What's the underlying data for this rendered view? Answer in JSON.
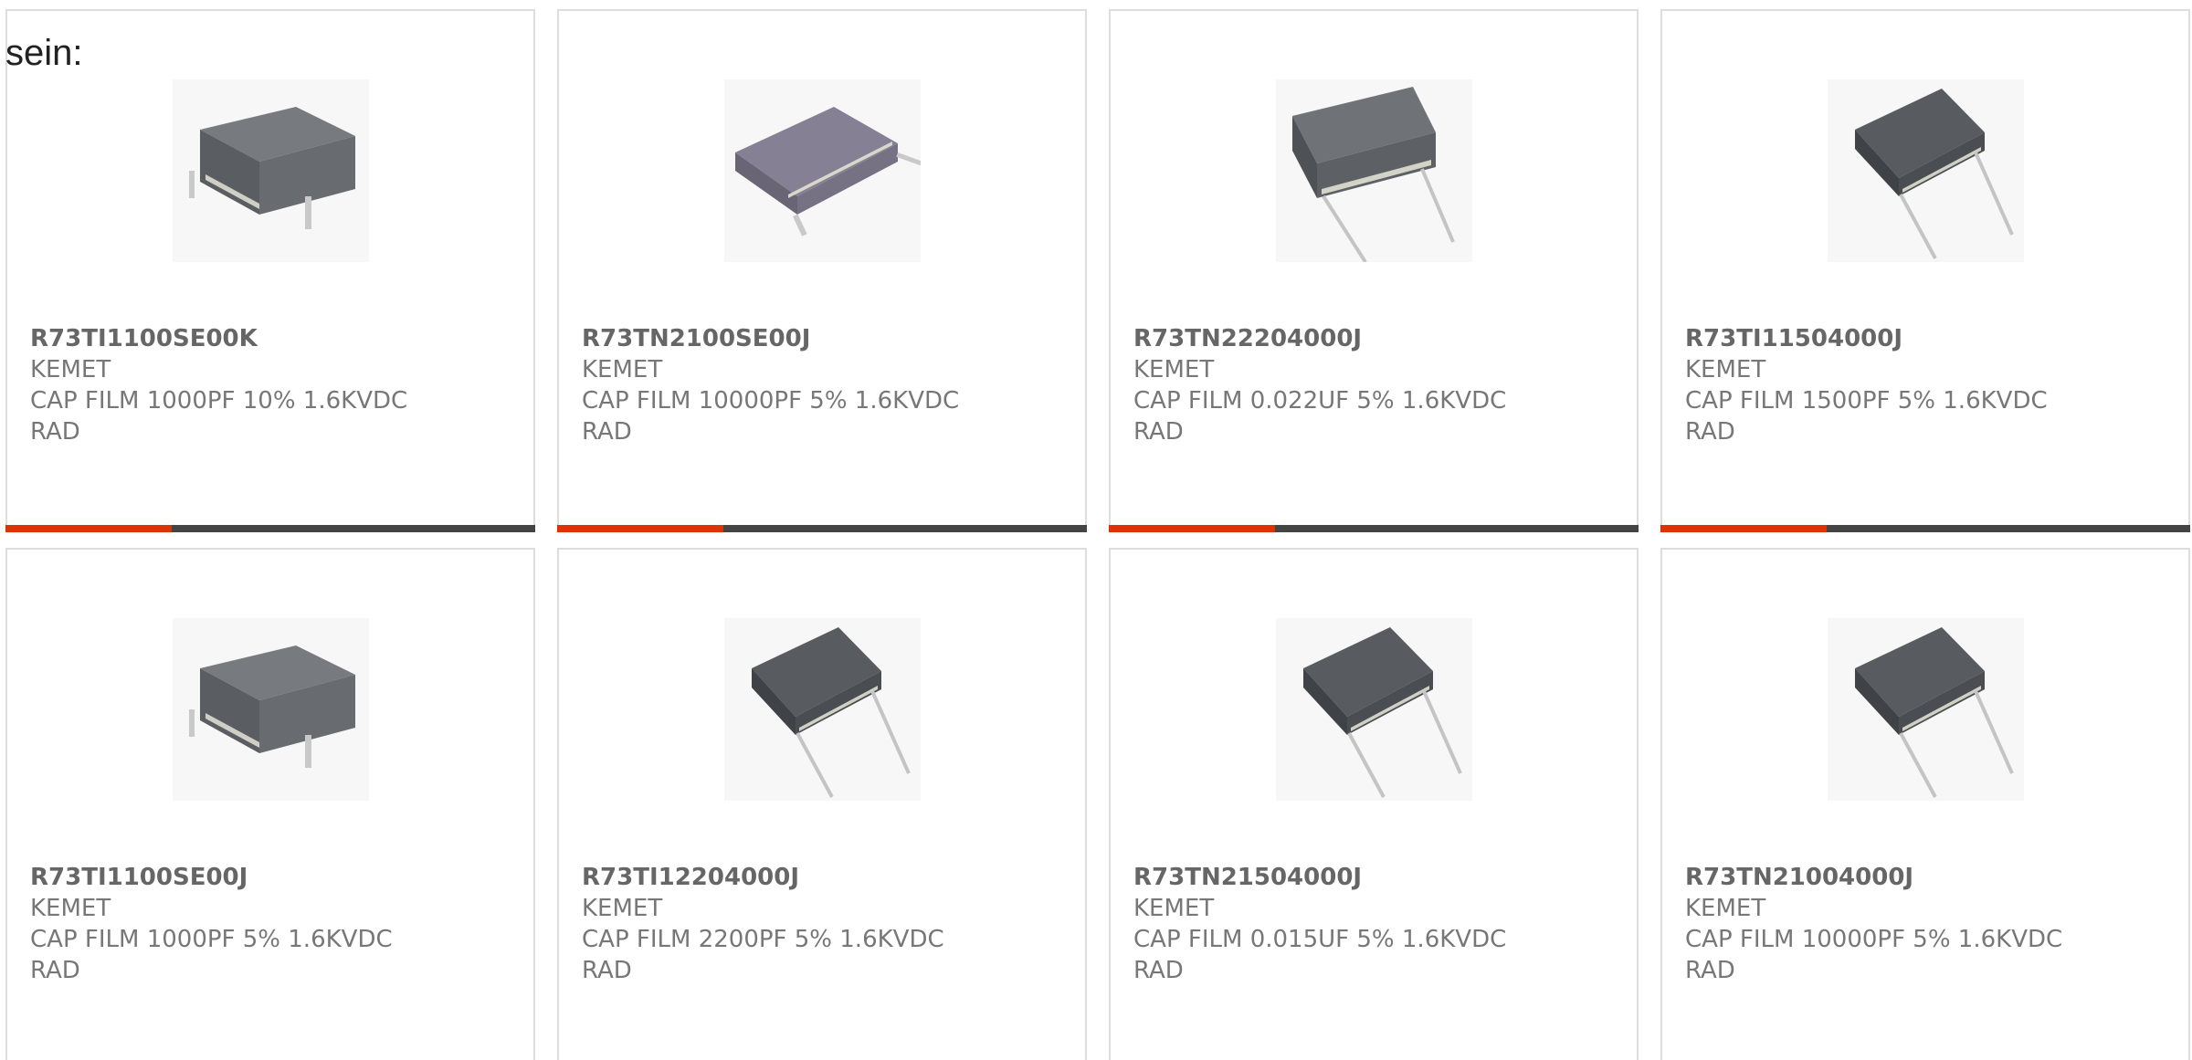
{
  "intro_text": "sein:",
  "colors": {
    "accent": "#dd3300",
    "bar": "#444444",
    "card_border": "#dddddd",
    "text": "#777777",
    "part_number": "#666666"
  },
  "products": [
    {
      "part_number": "R73TI1100SE00K",
      "manufacturer": "KEMET",
      "description_line1": "CAP FILM 1000PF 10% 1.6KVDC",
      "description_line2": "RAD",
      "image_icon": "film-capacitor-short-leads-icon"
    },
    {
      "part_number": "R73TN2100SE00J",
      "manufacturer": "KEMET",
      "description_line1": "CAP FILM 10000PF 5% 1.6KVDC",
      "description_line2": "RAD",
      "image_icon": "film-capacitor-flat-icon"
    },
    {
      "part_number": "R73TN22204000J",
      "manufacturer": "KEMET",
      "description_line1": "CAP FILM 0.022UF 5% 1.6KVDC",
      "description_line2": "RAD",
      "image_icon": "film-capacitor-long-leads-icon"
    },
    {
      "part_number": "R73TI11504000J",
      "manufacturer": "KEMET",
      "description_line1": "CAP FILM 1500PF 5% 1.6KVDC",
      "description_line2": "RAD",
      "image_icon": "film-capacitor-long-leads-icon"
    },
    {
      "part_number": "R73TI1100SE00J",
      "manufacturer": "KEMET",
      "description_line1": "CAP FILM 1000PF 5% 1.6KVDC",
      "description_line2": "RAD",
      "image_icon": "film-capacitor-short-leads-icon"
    },
    {
      "part_number": "R73TI12204000J",
      "manufacturer": "KEMET",
      "description_line1": "CAP FILM 2200PF 5% 1.6KVDC",
      "description_line2": "RAD",
      "image_icon": "film-capacitor-long-leads-icon"
    },
    {
      "part_number": "R73TN21504000J",
      "manufacturer": "KEMET",
      "description_line1": "CAP FILM 0.015UF 5% 1.6KVDC",
      "description_line2": "RAD",
      "image_icon": "film-capacitor-long-leads-icon"
    },
    {
      "part_number": "R73TN21004000J",
      "manufacturer": "KEMET",
      "description_line1": "CAP FILM 10000PF 5% 1.6KVDC",
      "description_line2": "RAD",
      "image_icon": "film-capacitor-long-leads-icon"
    }
  ]
}
